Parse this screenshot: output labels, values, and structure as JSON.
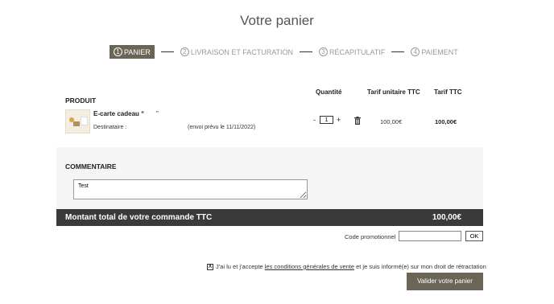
{
  "page": {
    "title": "Votre panier"
  },
  "steps": [
    {
      "num": "1",
      "label": "PANIER",
      "active": true
    },
    {
      "num": "2",
      "label": "LIVRAISON ET FACTURATION",
      "active": false
    },
    {
      "num": "3",
      "label": "RÉCAPITULATIF",
      "active": false
    },
    {
      "num": "4",
      "label": "PAIEMENT",
      "active": false
    }
  ],
  "table": {
    "col_produit": "PRODUIT",
    "col_quantite": "Quantité",
    "col_unit": "Tarif unitaire TTC",
    "col_total": "Tarif TTC"
  },
  "product": {
    "name": "E-carte cadeau “",
    "name_end": "”",
    "destinataire_label": "Destinataire :",
    "envoi": "(envoi prévu le 11/11/2022)",
    "qty_minus": "-",
    "qty_plus": "+",
    "quantity": "1",
    "unit_price": "100,00€",
    "total_price": "100,00€",
    "delete_icon": "trash-icon"
  },
  "comment": {
    "label": "COMMENTAIRE",
    "value": "Test"
  },
  "total": {
    "label": "Montant total de votre commande TTC",
    "value": "100,00€"
  },
  "promo": {
    "label": "Code promotionnel",
    "value": "",
    "button": "OK"
  },
  "terms": {
    "checked_mark": "X",
    "before": "J'ai lu et j'accepte",
    "link": "les conditions générales de vente",
    "after": "et je suis informé(e) sur mon droit de rétractation"
  },
  "validate_button": "Valider votre panier",
  "colors": {
    "accent": "#6b6558",
    "total_bar": "#3a3a3a",
    "comment_bg": "#f5f5f5"
  }
}
